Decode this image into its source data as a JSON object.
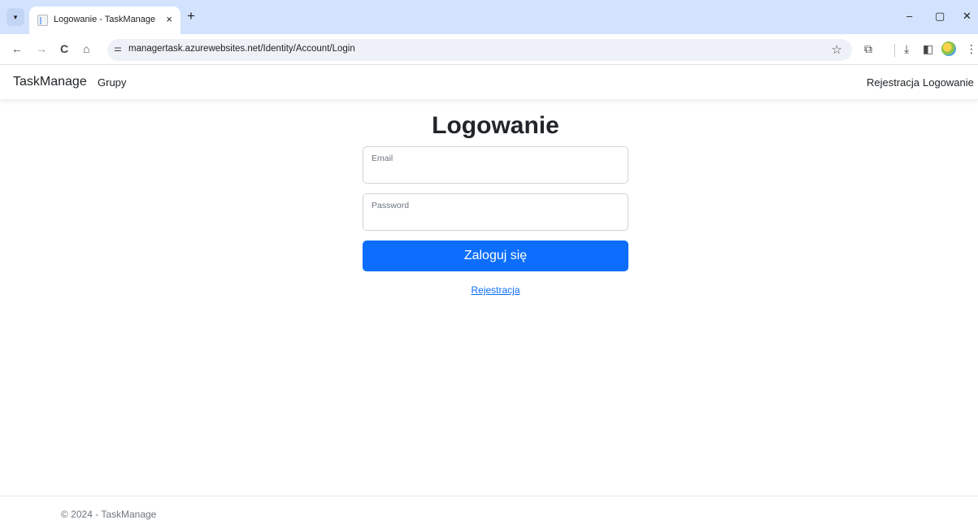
{
  "browser": {
    "tab_title": "Logowanie - TaskManage",
    "tab_close": "×",
    "new_tab": "+",
    "url": "managertask.azurewebsites.net/Identity/Account/Login",
    "icons": {
      "back": "←",
      "forward": "→",
      "reload": "C",
      "home": "⌂",
      "site_info": "⚌",
      "bookmark": "☆",
      "extensions": "⧉",
      "download": "⤓",
      "sidepanel": "◧",
      "menu": "⋮",
      "minimize": "–",
      "restore": "▢",
      "close": "✕",
      "tab_search": "▾"
    }
  },
  "navbar": {
    "brand": "TaskManage",
    "left_links": [
      "Grupy"
    ],
    "right_links": [
      "Rejestracja",
      "Logowanie"
    ]
  },
  "login": {
    "title": "Logowanie",
    "email_label": "Email",
    "password_label": "Password",
    "submit_label": "Zaloguj się",
    "register_link": "Rejestracja"
  },
  "footer": {
    "text": "© 2024 - TaskManage"
  },
  "colors": {
    "primary": "#0d6efd",
    "chrome_tabstrip": "#d3e3fd"
  }
}
